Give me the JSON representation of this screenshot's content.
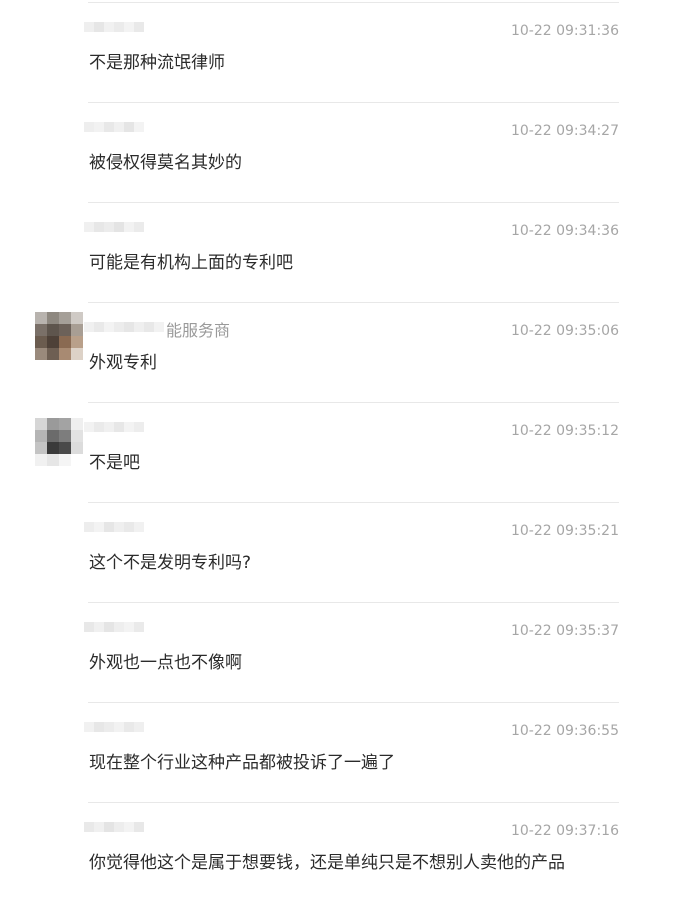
{
  "messages": [
    {
      "time": "10-22 09:31:36",
      "text": "不是那种流氓律师",
      "name_visible": "",
      "has_avatar": false
    },
    {
      "time": "10-22 09:34:27",
      "text": "被侵权得莫名其妙的",
      "name_visible": "",
      "has_avatar": false
    },
    {
      "time": "10-22 09:34:36",
      "text": "可能是有机构上面的专利吧",
      "name_visible": "",
      "has_avatar": false
    },
    {
      "time": "10-22 09:35:06",
      "text": "外观专利",
      "name_visible": "能服务商",
      "has_avatar": true
    },
    {
      "time": "10-22 09:35:12",
      "text": "不是吧",
      "name_visible": "",
      "has_avatar": true
    },
    {
      "time": "10-22 09:35:21",
      "text": "这个不是发明专利吗?",
      "name_visible": "",
      "has_avatar": false
    },
    {
      "time": "10-22 09:35:37",
      "text": "外观也一点也不像啊",
      "name_visible": "",
      "has_avatar": false
    },
    {
      "time": "10-22 09:36:55",
      "text": "现在整个行业这种产品都被投诉了一遍了",
      "name_visible": "",
      "has_avatar": false
    },
    {
      "time": "10-22 09:37:16",
      "text": "你觉得他这个是属于想要钱，还是单纯只是不想别人卖他的产品",
      "name_visible": "",
      "has_avatar": false
    }
  ]
}
